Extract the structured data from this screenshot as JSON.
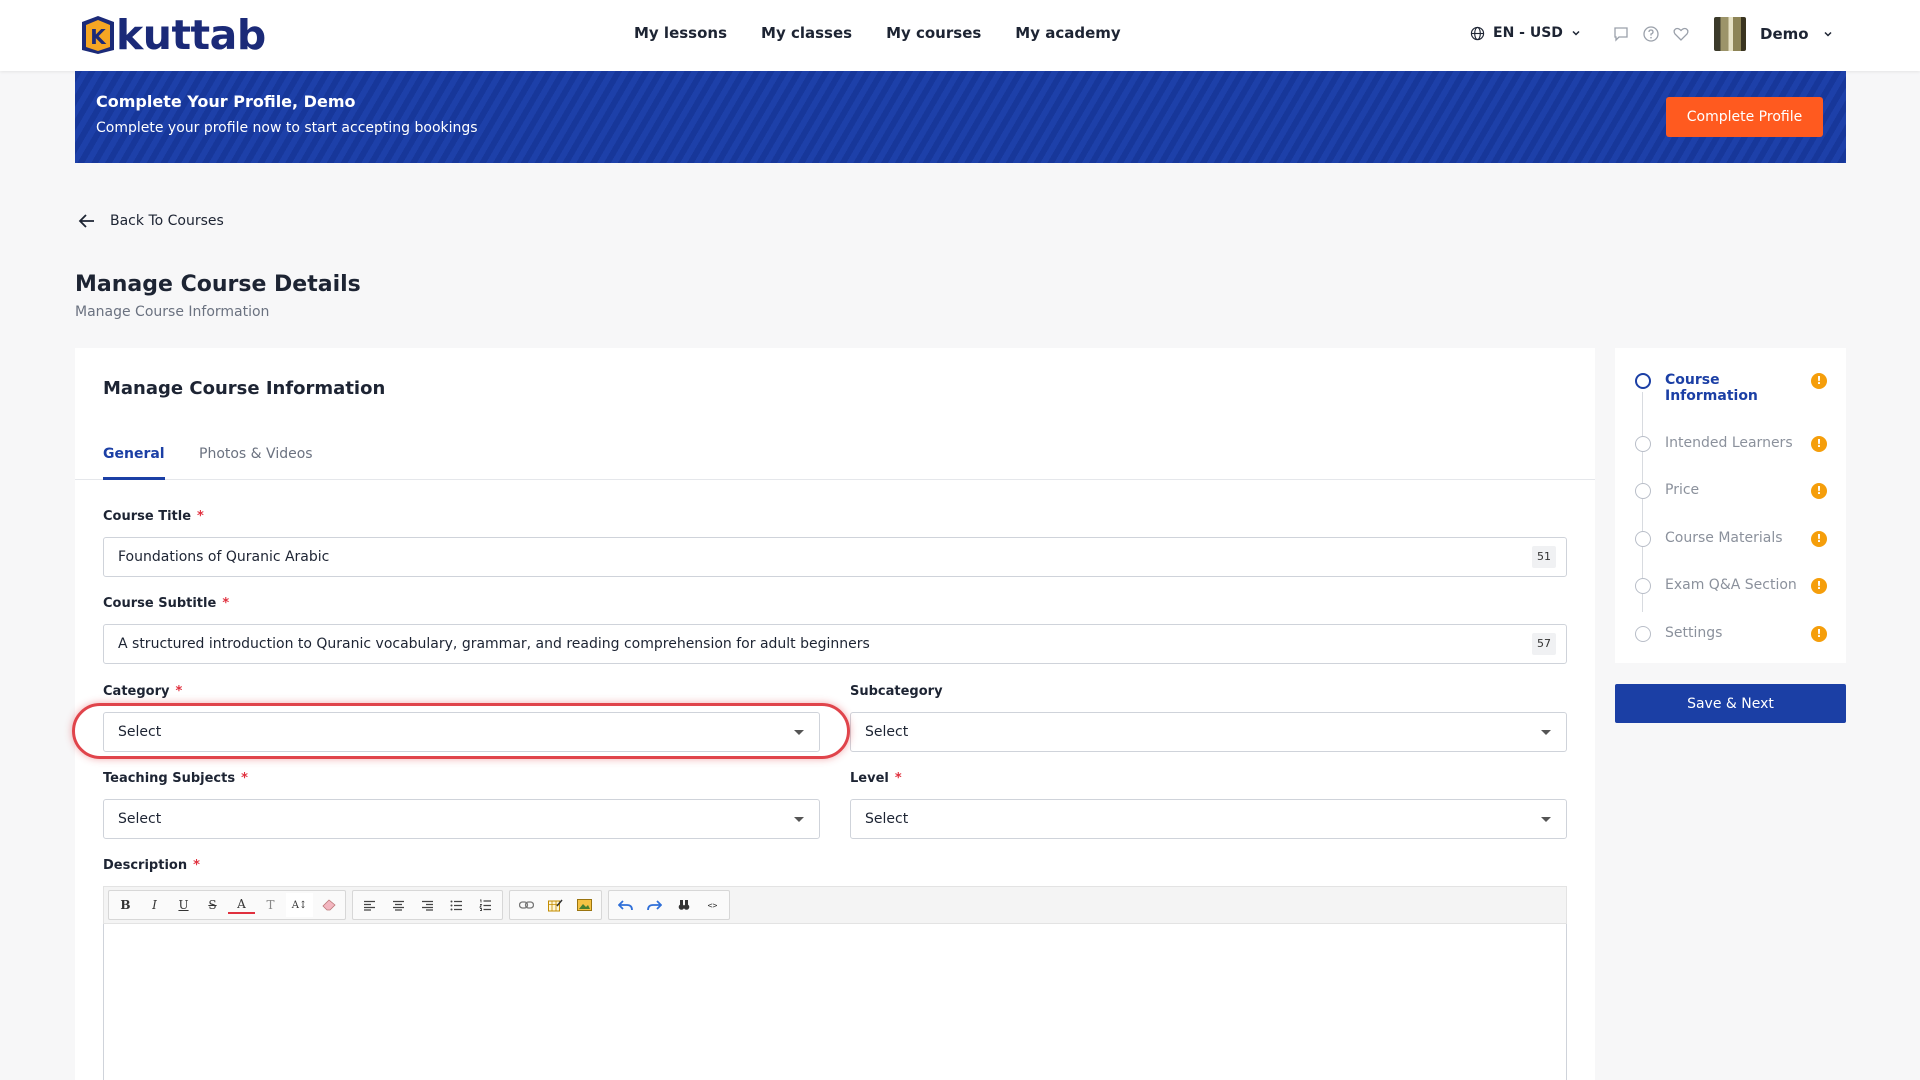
{
  "brand": {
    "name": "kuttab",
    "logo_letter": "K"
  },
  "nav": {
    "items": [
      "My lessons",
      "My classes",
      "My courses",
      "My academy"
    ]
  },
  "locale": {
    "label": "EN - USD"
  },
  "user": {
    "name": "Demo"
  },
  "banner": {
    "title": "Complete Your Profile, Demo",
    "text": "Complete your profile now to start accepting bookings",
    "button": "Complete Profile"
  },
  "back": {
    "label": "Back To Courses"
  },
  "page": {
    "title": "Manage Course Details",
    "subtitle": "Manage Course Information"
  },
  "card": {
    "title": "Manage Course Information",
    "tabs": [
      "General",
      "Photos & Videos"
    ],
    "active_tab": "General"
  },
  "form": {
    "course_title": {
      "label": "Course Title",
      "value": "Foundations of Quranic Arabic",
      "counter": "51"
    },
    "course_subtitle": {
      "label": "Course Subtitle",
      "value": "A structured introduction to Quranic vocabulary, grammar, and reading comprehension for adult beginners",
      "counter": "57"
    },
    "category": {
      "label": "Category",
      "value": "Select"
    },
    "subcategory": {
      "label": "Subcategory",
      "value": "Select"
    },
    "teaching_subjects": {
      "label": "Teaching Subjects",
      "value": "Select"
    },
    "level": {
      "label": "Level",
      "value": "Select"
    },
    "description": {
      "label": "Description"
    },
    "required_mark": "*"
  },
  "toolbar": {
    "bold": "B",
    "italic": "I",
    "underline": "U",
    "strike": "S",
    "font_color": "A",
    "text_style": "T",
    "font_size": "A↕",
    "code": "<>"
  },
  "steps": {
    "items": [
      {
        "label": "Course Information",
        "active": true
      },
      {
        "label": "Intended Learners",
        "active": false
      },
      {
        "label": "Price",
        "active": false
      },
      {
        "label": "Course Materials",
        "active": false
      },
      {
        "label": "Exam Q&A Section",
        "active": false
      },
      {
        "label": "Settings",
        "active": false
      }
    ],
    "warn_mark": "!"
  },
  "save_button": "Save & Next",
  "colors": {
    "primary": "#1b3fa5",
    "accent": "#ff5a1f",
    "warning": "#f59e0b",
    "required": "#e0303e",
    "highlight": "#e0444b"
  }
}
